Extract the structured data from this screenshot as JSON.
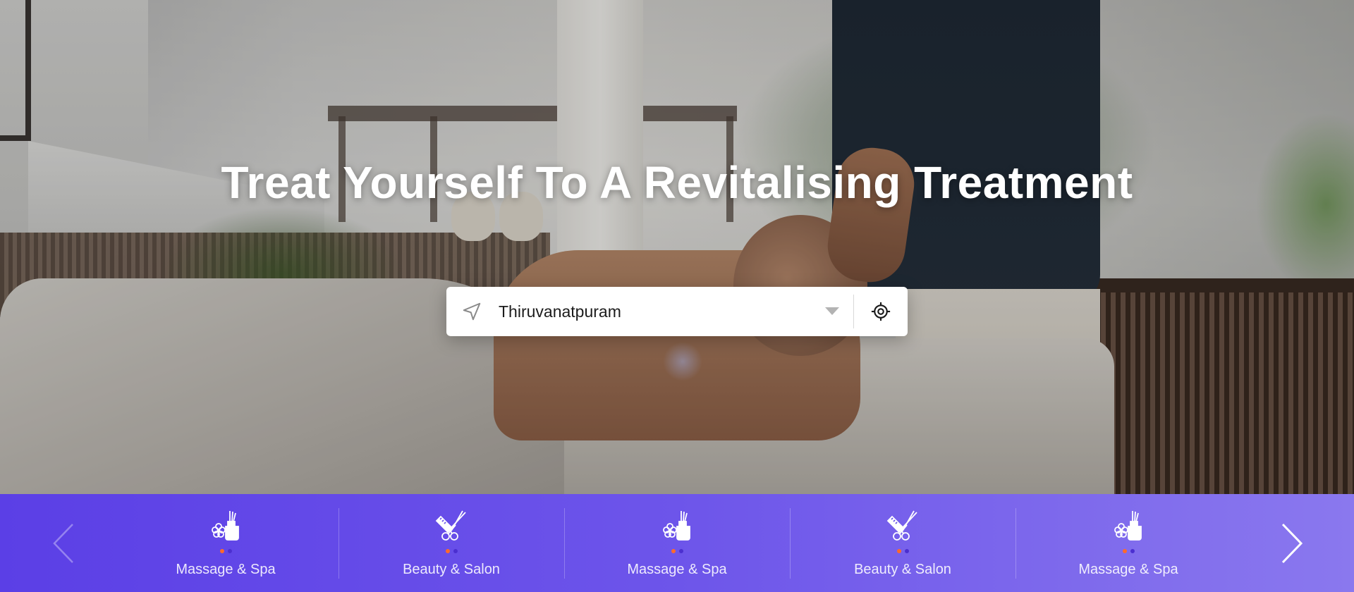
{
  "hero": {
    "title": "Treat Yourself To A Revitalising Treatment",
    "background_icon": "spa-massage-photo"
  },
  "search": {
    "location_value": "Thiruvanatpuram",
    "location_icon": "navigation-arrow-icon",
    "dropdown_icon": "caret-down-icon",
    "locate_icon": "crosshair-locate-icon"
  },
  "categories": {
    "prev_icon": "chevron-left-icon",
    "next_icon": "chevron-right-icon",
    "items": [
      {
        "label": "Massage & Spa",
        "icon": "spa-flower-bottle-icon"
      },
      {
        "label": "Beauty & Salon",
        "icon": "scissors-comb-icon"
      },
      {
        "label": "Massage & Spa",
        "icon": "spa-flower-bottle-icon"
      },
      {
        "label": "Beauty & Salon",
        "icon": "scissors-comb-icon"
      },
      {
        "label": "Massage & Spa",
        "icon": "spa-flower-bottle-icon"
      }
    ]
  },
  "colors": {
    "bar_start": "#5b3fe6",
    "bar_end": "#8a78ee",
    "dot_orange": "#ff6a2a",
    "dot_purple": "#4b2fd0"
  }
}
